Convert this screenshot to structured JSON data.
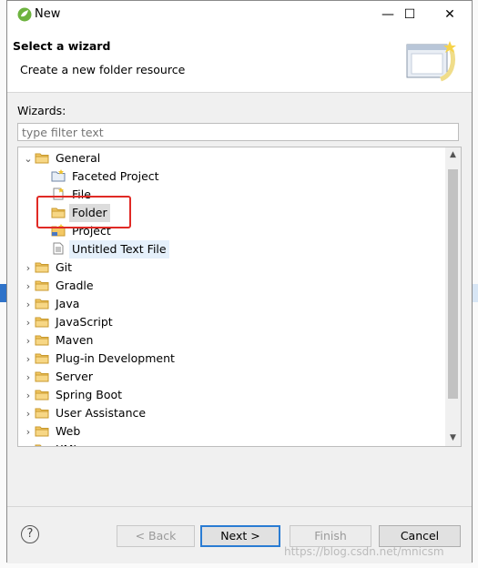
{
  "window": {
    "title": "New",
    "minimize": "—",
    "maximize": "☐",
    "close": "✕"
  },
  "header": {
    "title": "Select a wizard",
    "description": "Create a new folder resource"
  },
  "wizards": {
    "label": "Wizards:",
    "filter_placeholder": "type filter text"
  },
  "tree": [
    {
      "label": "General",
      "expanded": true,
      "level": 0
    },
    {
      "label": "Faceted Project",
      "level": 1
    },
    {
      "label": "File",
      "level": 1
    },
    {
      "label": "Folder",
      "level": 1,
      "selected": true
    },
    {
      "label": "Project",
      "level": 1
    },
    {
      "label": "Untitled Text File",
      "level": 1
    },
    {
      "label": "Git",
      "level": 0
    },
    {
      "label": "Gradle",
      "level": 0
    },
    {
      "label": "Java",
      "level": 0
    },
    {
      "label": "JavaScript",
      "level": 0
    },
    {
      "label": "Maven",
      "level": 0
    },
    {
      "label": "Plug-in Development",
      "level": 0
    },
    {
      "label": "Server",
      "level": 0
    },
    {
      "label": "Spring Boot",
      "level": 0
    },
    {
      "label": "User Assistance",
      "level": 0
    },
    {
      "label": "Web",
      "level": 0
    },
    {
      "label": "XML",
      "level": 0
    }
  ],
  "buttons": {
    "help": "?",
    "back": "< Back",
    "next": "Next >",
    "finish": "Finish",
    "cancel": "Cancel"
  },
  "watermark": "https://blog.csdn.net/mnicsm",
  "colors": {
    "highlight": "#e02a25",
    "folder": "#e8b64a",
    "default_button_border": "#2a7cd3"
  }
}
